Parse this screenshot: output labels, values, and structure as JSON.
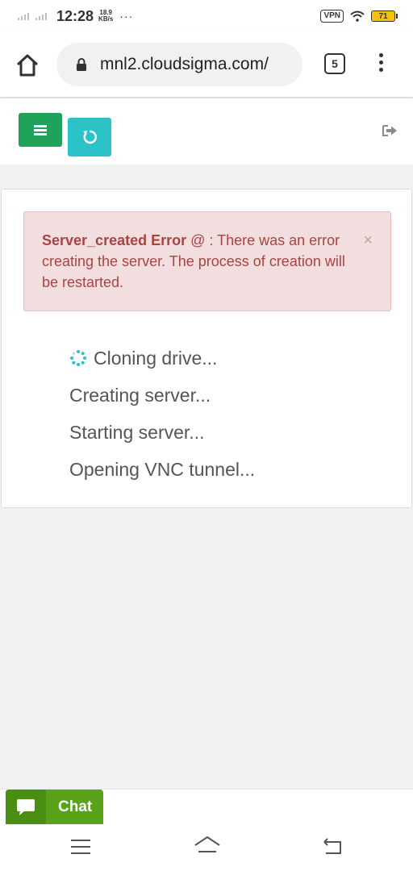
{
  "status_bar": {
    "time": "12:28",
    "speed_value": "18.9",
    "speed_unit": "KB/s",
    "more": "···",
    "vpn": "VPN",
    "battery": "71"
  },
  "browser": {
    "url": "mnl2.cloudsigma.com/",
    "tab_count": "5"
  },
  "alert": {
    "title": "Server_created Error",
    "message": " @ : There was an error creating the server. The process of creation will be restarted.",
    "close": "×"
  },
  "steps": [
    {
      "label": "Cloning drive..."
    },
    {
      "label": "Creating server..."
    },
    {
      "label": "Starting server..."
    },
    {
      "label": "Opening VNC tunnel..."
    }
  ],
  "chat": {
    "label": "Chat"
  },
  "colors": {
    "menu_button": "#1fa35b",
    "refresh_button": "#2bc3c7",
    "alert_bg": "#f2dede",
    "alert_text": "#a94442",
    "chat_button": "#5aa21a",
    "spinner": "#2bc3c7"
  },
  "icons": {
    "home": "home-icon",
    "lock": "lock-icon",
    "menu": "hamburger-icon",
    "refresh": "refresh-icon",
    "signout": "sign-out-icon",
    "spinner": "spinner-icon",
    "chat": "chat-bubble-icon"
  }
}
